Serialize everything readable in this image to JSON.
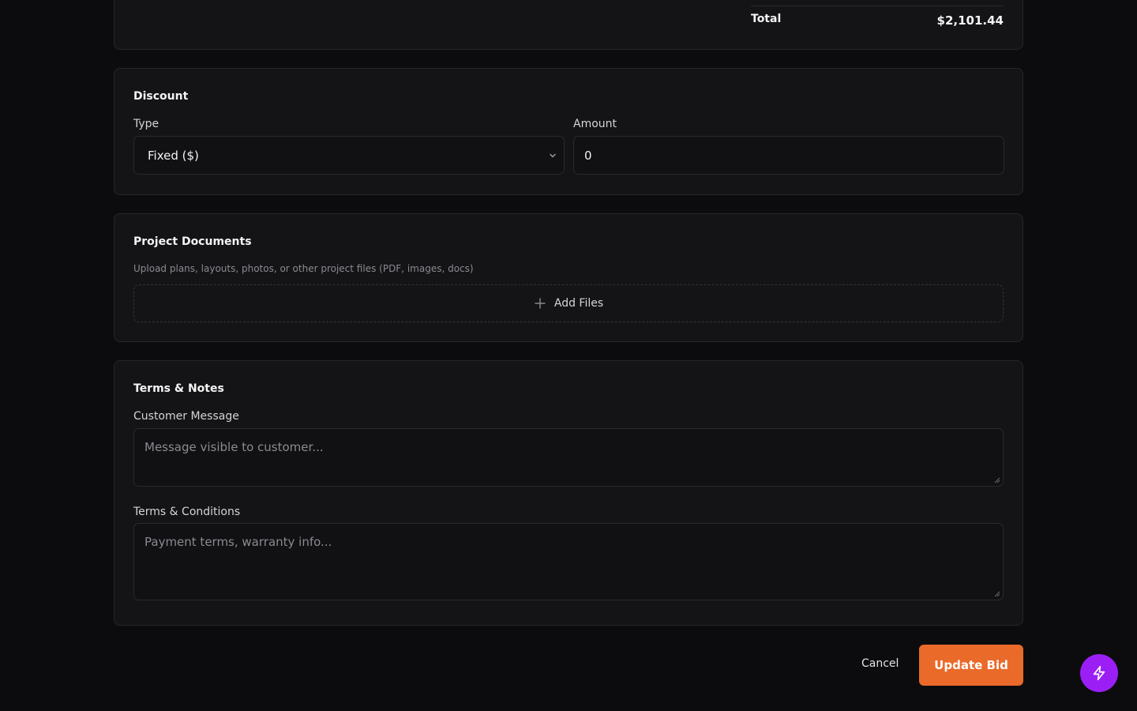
{
  "totals": {
    "total_label": "Total",
    "total_value": "$2,101.44"
  },
  "discount": {
    "title": "Discount",
    "type_label": "Type",
    "type_value": "Fixed ($)",
    "amount_label": "Amount",
    "amount_value": "0"
  },
  "documents": {
    "title": "Project Documents",
    "description": "Upload plans, layouts, photos, or other project files (PDF, images, docs)",
    "add_files_label": "Add Files"
  },
  "terms": {
    "title": "Terms & Notes",
    "customer_message_label": "Customer Message",
    "customer_message_placeholder": "Message visible to customer...",
    "conditions_label": "Terms & Conditions",
    "conditions_placeholder": "Payment terms, warranty info..."
  },
  "actions": {
    "cancel_label": "Cancel",
    "update_label": "Update Bid"
  },
  "colors": {
    "accent": "#ea6a2a",
    "fab": "#9b1ff5",
    "background": "#0c0c0e",
    "card": "#141416"
  },
  "icons": {
    "select_chevron": "chevron-down-icon",
    "add_files": "plus-icon",
    "fab": "lightning-icon"
  }
}
